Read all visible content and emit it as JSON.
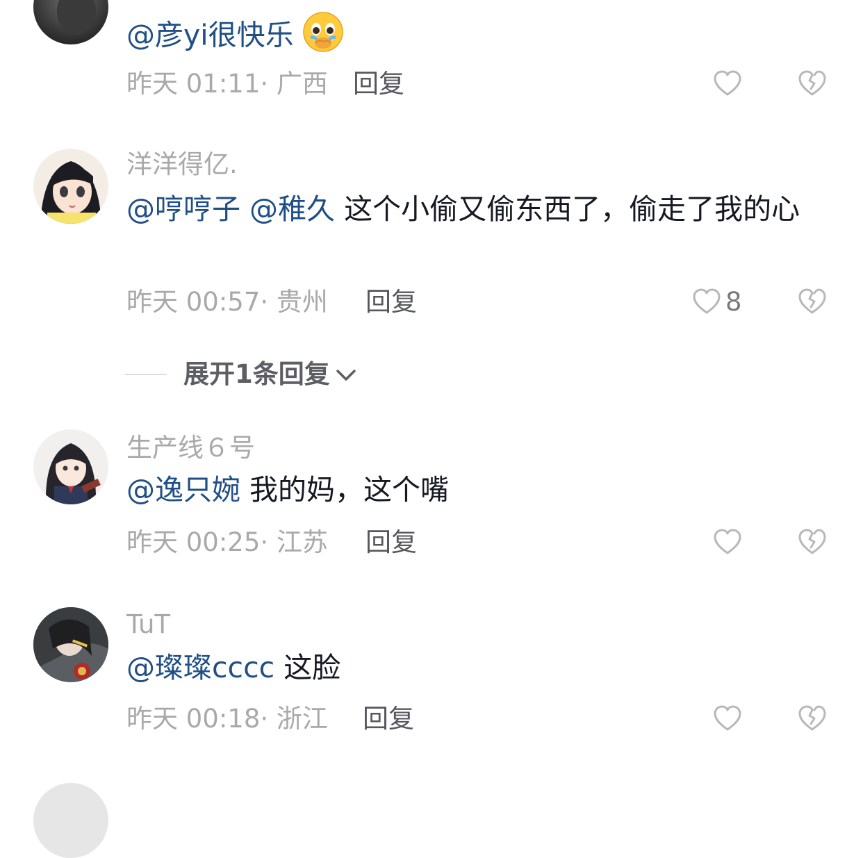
{
  "comments": [
    {
      "username": "",
      "mentions": [
        "@彦yi很快乐"
      ],
      "text": "",
      "emoji": "pleading-face-emoji",
      "time": "昨天 01:11",
      "location": "广西",
      "reply_label": "回复",
      "likes": ""
    },
    {
      "username": "洋洋得亿.",
      "mentions": [
        "@哼哼子",
        "@稚久"
      ],
      "text": "这个小偷又偷东西了，偷走了我的心",
      "time": "昨天 00:57",
      "location": "贵州",
      "reply_label": "回复",
      "likes": "8"
    },
    {
      "username": "生产线６号",
      "mentions": [
        "@逸只婉"
      ],
      "text": "我的妈，这个嘴",
      "time": "昨天 00:25",
      "location": "江苏",
      "reply_label": "回复",
      "likes": ""
    },
    {
      "username": "TuT",
      "mentions": [
        "@璨璨cccc"
      ],
      "text": "这脸",
      "time": "昨天 00:18",
      "location": "浙江",
      "reply_label": "回复",
      "likes": ""
    }
  ],
  "expand_replies": {
    "label": "展开1条回复"
  },
  "colors": {
    "mention": "#1f4f86",
    "text": "#161823",
    "meta": "#a9a9a9",
    "reply": "#55575c"
  },
  "meta_separator": "· "
}
